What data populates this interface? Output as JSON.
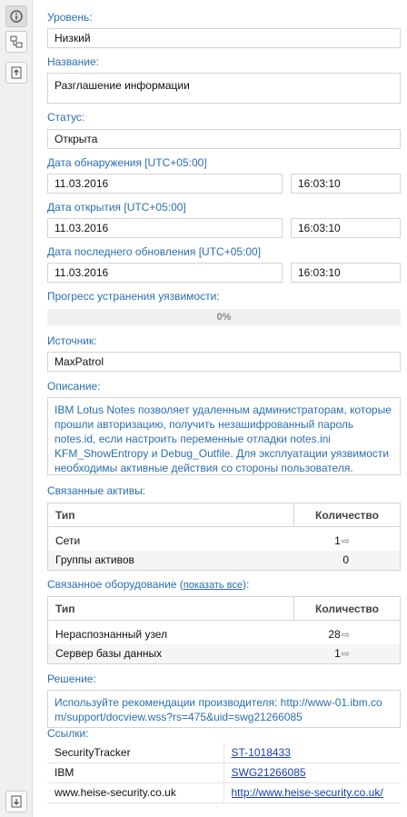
{
  "toolbar": {
    "info_icon": "info-icon",
    "hierarchy_icon": "hierarchy-icon",
    "upload_icon": "upload-icon",
    "download_icon": "download-icon"
  },
  "level": {
    "label": "Уровень:",
    "value": "Низкий"
  },
  "name": {
    "label": "Название:",
    "value": "Разглашение информации"
  },
  "status": {
    "label": "Статус:",
    "value": "Открыта"
  },
  "detect": {
    "label": "Дата обнаружения [UTC+05:00]",
    "date": "11.03.2016",
    "time": "16:03:10"
  },
  "open": {
    "label": "Дата открытия [UTC+05:00]",
    "date": "11.03.2016",
    "time": "16:03:10"
  },
  "updated": {
    "label": "Дата последнего обновления [UTC+05:00]",
    "date": "11.03.2016",
    "time": "16:03:10"
  },
  "progress": {
    "label": "Прогресс устранения уязвимости:",
    "text": "0%",
    "fraction": 0
  },
  "source": {
    "label": "Источник:",
    "value": "MaxPatrol"
  },
  "description": {
    "label": "Описание:",
    "text": "IBM Lotus Notes позволяет удаленным администраторам, которые прошли авторизацию, получить незашифрованный пароль notes.id, если настроить переменные отладки notes.ini KFM_ShowEntropy и Debug_Outfile. Для эксплуатации уязвимости необходимы активные действия со стороны пользователя."
  },
  "assets": {
    "label": "Связанные активы:",
    "col_type": "Тип",
    "col_qty": "Количество",
    "rows": [
      {
        "type": "Сети",
        "qty": "1",
        "arrow": true
      },
      {
        "type": "Группы активов",
        "qty": "0",
        "arrow": false
      }
    ]
  },
  "equipment": {
    "label": "Связанное оборудование (",
    "link": "показать все",
    "label_end": "):",
    "col_type": "Тип",
    "col_qty": "Количество",
    "rows": [
      {
        "type": "Нераспознанный узел",
        "qty": "28",
        "arrow": true
      },
      {
        "type": "Сервер базы данных",
        "qty": "1",
        "arrow": true
      }
    ]
  },
  "solution": {
    "label": "Решение:",
    "text": "Используйте рекомендации производителя: http://www-01.ibm.com/support/docview.wss?rs=475&uid=swg21266085"
  },
  "links": {
    "label": "Ссылки:",
    "rows": [
      {
        "name": "SecurityTracker",
        "ref": "ST-1018433"
      },
      {
        "name": "IBM",
        "ref": "SWG21266085"
      },
      {
        "name": "www.heise-security.co.uk",
        "ref": "http://www.heise-security.co.uk/"
      }
    ]
  }
}
